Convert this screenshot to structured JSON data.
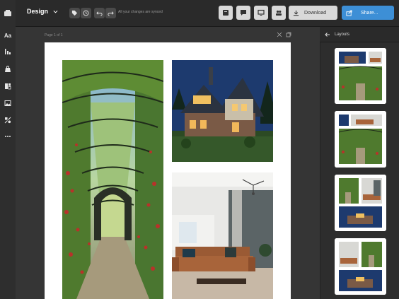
{
  "topbar": {
    "menu_label": "Design",
    "saved_status": "All your changes are synced",
    "download_label": "Download",
    "share_label": "Share..."
  },
  "sidebar": {
    "text_tool_label": "Aa",
    "icons": [
      "template-icon",
      "text-icon",
      "chart-icon",
      "bag-icon",
      "layout-icon",
      "image-icon",
      "shapes-icon",
      "more-icon"
    ]
  },
  "canvas": {
    "page_label": "Page 1 of 1",
    "photos": [
      "garden-arch-photo",
      "house-photo",
      "living-room-photo"
    ]
  },
  "layouts_panel": {
    "title": "Layouts",
    "thumbnails": [
      "layout-1",
      "layout-2",
      "layout-3",
      "layout-4"
    ]
  },
  "colors": {
    "share_blue": "#3d8fd6",
    "topbar": "#2a2a2a",
    "canvas_bg": "#353535"
  }
}
